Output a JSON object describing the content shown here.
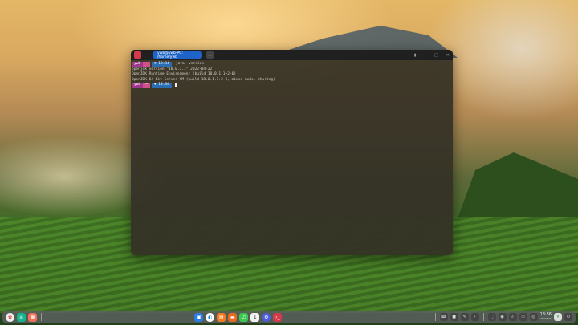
{
  "terminal": {
    "tab_title": "ywb@ywb-PC: /home/ywb",
    "new_tab": "+",
    "lines": [
      {
        "type": "prompt",
        "user": "ywb",
        "host_glyph": "~",
        "time": "18:34",
        "command": "java -version"
      },
      {
        "type": "output",
        "text": "openjdk version \"18.0.1.1\" 2022-04-22"
      },
      {
        "type": "output",
        "text": "OpenJDK Runtime Environment (build 18.0.1.1+2-6)"
      },
      {
        "type": "output",
        "text": "OpenJDK 64-Bit Server VM (build 18.0.1.1+2-6, mixed mode, sharing)"
      },
      {
        "type": "prompt",
        "user": "ywb",
        "host_glyph": "~",
        "time": "18:34",
        "command": ""
      }
    ]
  },
  "taskbar": {
    "clock": "18:36",
    "date": "2022/6/2"
  }
}
